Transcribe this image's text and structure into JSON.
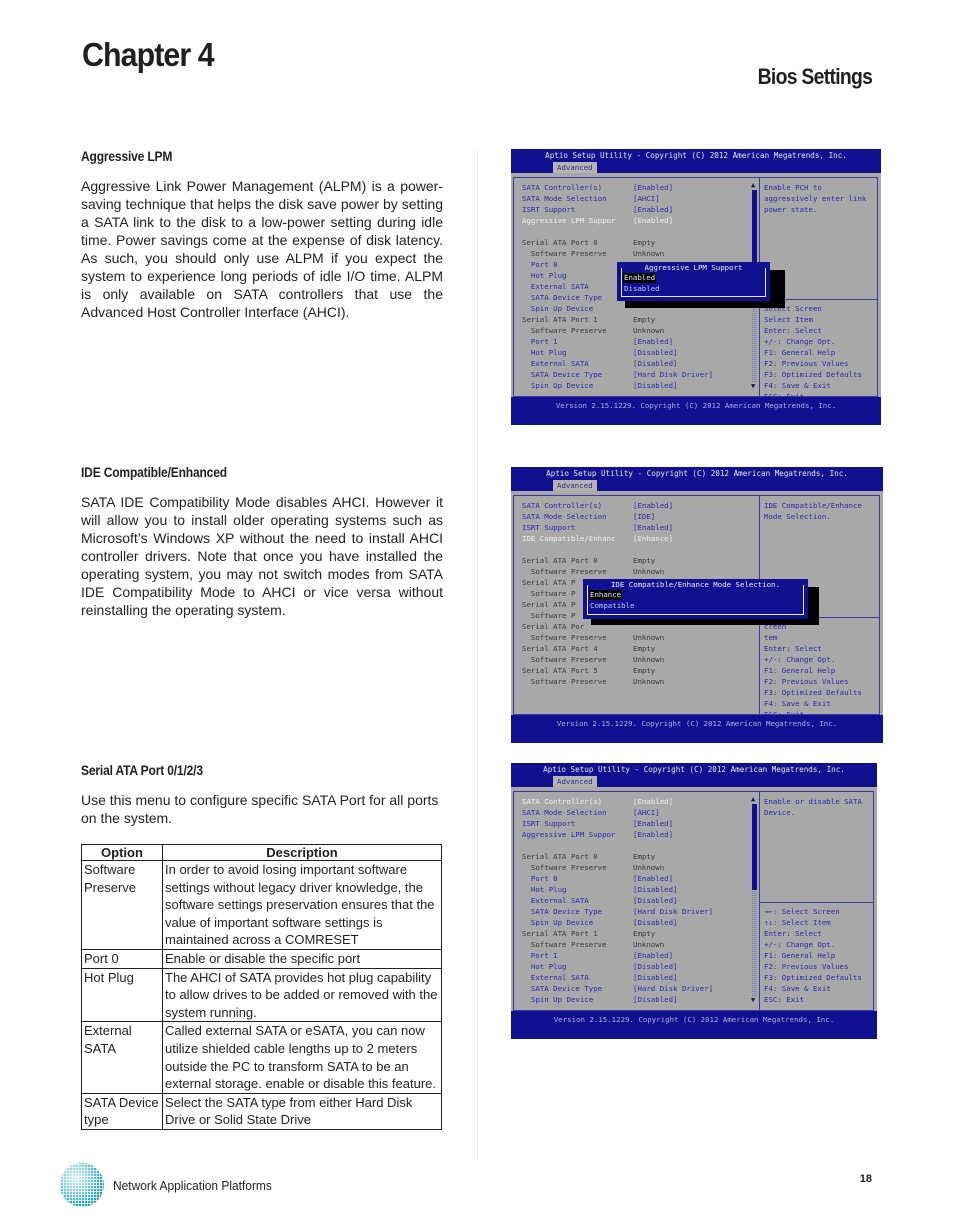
{
  "header": {
    "chapter": "Chapter 4",
    "section": "Bios Settings"
  },
  "sections": [
    {
      "heading": "Aggressive LPM",
      "paragraph": "Aggressive Link Power Management (ALPM) is a power-saving technique that helps the disk save power by setting a SATA link to the disk to a low-power setting during idle time.  Power savings come at the expense of disk latency.  As such, you should only use ALPM if you expect the system to experience long periods of idle I/O time.  ALPM is only available on SATA controllers that use the Advanced Host Controller Interface (AHCI)."
    },
    {
      "heading": "IDE Compatible/Enhanced",
      "paragraph": "SATA IDE Compatibility Mode disables AHCI. However it will allow you to install older operating systems such as Microsoft’s Windows XP without the need to install AHCI controller drivers.  Note that once you have installed the operating system, you may not switch modes from SATA IDE Compatibility Mode to AHCI or vice versa without reinstalling the operating system."
    },
    {
      "heading": "Serial ATA Port 0/1/2/3",
      "paragraph": "Use this menu to configure specific SATA Port for all ports on the system.",
      "table": {
        "headers": [
          "Option",
          "Description"
        ],
        "rows": [
          {
            "option": "Software Preserve",
            "description": "In order to avoid losing important software settings without legacy driver knowledge, the software settings preservation ensures that the value of important software settings is maintained across a COMRESET"
          },
          {
            "option": "Port 0",
            "description": "Enable or disable the specific port"
          },
          {
            "option": "Hot Plug",
            "description": "The AHCI of SATA provides hot plug capability to allow drives to be added or removed with the system running."
          },
          {
            "option": "External SATA",
            "description": "Called external SATA or eSATA, you can now utilize shielded cable lengths up to 2 meters outside the PC to transform SATA to be an external storage. enable or disable this feature."
          },
          {
            "option": "SATA Device type",
            "description": "Select the SATA type from either Hard Disk Drive or Solid State Drive"
          }
        ]
      }
    }
  ],
  "bios_common": {
    "title": "Aptio Setup Utility - Copyright (C) 2012 American Megatrends, Inc.",
    "tab": "Advanced",
    "version": "Version 2.15.1229. Copyright (C) 2012 American Megatrends, Inc."
  },
  "bios1": {
    "rows": [
      {
        "label": "SATA Controller(s)",
        "value": "[Enabled]"
      },
      {
        "label": "SATA Mode Selection",
        "value": "[AHCI]"
      },
      {
        "label": "ISRT Support",
        "value": "[Enabled]"
      },
      {
        "label": "Aggressive LPM Suppor",
        "value": "[Enabled]"
      },
      {
        "label": "",
        "value": ""
      },
      {
        "label": "Serial ATA Port 0",
        "value": "Empty"
      },
      {
        "label": "  Software Preserve",
        "value": "Unknown"
      },
      {
        "label": "  Port 0",
        "value": ""
      },
      {
        "label": "  Hot Plug",
        "value": ""
      },
      {
        "label": "  External SATA",
        "value": ""
      },
      {
        "label": "  SATA Device Type",
        "value": ""
      },
      {
        "label": "  Spin Up Device",
        "value": ""
      },
      {
        "label": "Serial ATA Port 1",
        "value": "Empty"
      },
      {
        "label": "  Software Preserve",
        "value": "Unknown"
      },
      {
        "label": "  Port 1",
        "value": "[Enabled]"
      },
      {
        "label": "  Hot Plug",
        "value": "[Disabled]"
      },
      {
        "label": "  External SATA",
        "value": "[Disabled]"
      },
      {
        "label": "  SATA Device Type",
        "value": "[Hard Disk Driver]"
      },
      {
        "label": "  Spin Up Device",
        "value": "[Disabled]"
      }
    ],
    "help": [
      "Enable PCH to",
      "aggressively enter link",
      "power state."
    ],
    "keys": [
      "Select Screen",
      "Select Item",
      "Enter: Select",
      "+/-: Change Opt.",
      "F1: General Help",
      "F2: Previous Values",
      "F3: Optimized Defaults",
      "F4: Save & Exit",
      "ESC: Exit"
    ],
    "popup": {
      "title": "Aggressive LPM Support",
      "options": [
        "Enabled",
        "Disabled"
      ],
      "selected": "Enabled"
    }
  },
  "bios2": {
    "rows": [
      {
        "label": "SATA Controller(s)",
        "value": "[Enabled]"
      },
      {
        "label": "SATA Mode Selection",
        "value": "[IDE]"
      },
      {
        "label": "ISRT Support",
        "value": "[Enabled]"
      },
      {
        "label": "IDE Compatible/Enhanc",
        "value": "[Enhance]"
      },
      {
        "label": "",
        "value": ""
      },
      {
        "label": "Serial ATA Port 0",
        "value": "Empty"
      },
      {
        "label": "  Software Preserve",
        "value": "Unknown"
      },
      {
        "label": "Serial ATA P",
        "value": ""
      },
      {
        "label": "  Software P",
        "value": ""
      },
      {
        "label": "Serial ATA P",
        "value": ""
      },
      {
        "label": "  Software P",
        "value": ""
      },
      {
        "label": "Serial ATA Por",
        "value": ""
      },
      {
        "label": "  Software Preserve",
        "value": "Unknown"
      },
      {
        "label": "Serial ATA Port 4",
        "value": "Empty"
      },
      {
        "label": "  Software Preserve",
        "value": "Unknown"
      },
      {
        "label": "Serial ATA Port 5",
        "value": "Empty"
      },
      {
        "label": "  Software Preserve",
        "value": "Unknown"
      }
    ],
    "help": [
      "IDE Compatible/Enhance",
      "Mode Selection."
    ],
    "keys": [
      "creen",
      "tem",
      "Enter: Select",
      "+/-: Change Opt.",
      "F1: General Help",
      "F2: Previous Values",
      "F3: Optimized Defaults",
      "F4: Save & Exit",
      "ESC: Exit"
    ],
    "popup": {
      "title": "IDE Compatible/Enhance Mode Selection.",
      "options": [
        "Enhance",
        "Compatible"
      ],
      "selected": "Enhance"
    }
  },
  "bios3": {
    "rows": [
      {
        "label": "SATA Controller(s)",
        "value": "[Enabled]"
      },
      {
        "label": "SATA Mode Selection",
        "value": "[AHCI]"
      },
      {
        "label": "ISRT Support",
        "value": "[Enabled]"
      },
      {
        "label": "Aggressive LPM Suppor",
        "value": "[Enabled]"
      },
      {
        "label": "",
        "value": ""
      },
      {
        "label": "Serial ATA Port 0",
        "value": "Empty"
      },
      {
        "label": "  Software Preserve",
        "value": "Unknown"
      },
      {
        "label": "  Port 0",
        "value": "[Enabled]"
      },
      {
        "label": "  Hot Plug",
        "value": "[Disabled]"
      },
      {
        "label": "  External SATA",
        "value": "[Disabled]"
      },
      {
        "label": "  SATA Device Type",
        "value": "[Hard Disk Driver]"
      },
      {
        "label": "  Spin Up Device",
        "value": "[Disabled]"
      },
      {
        "label": "Serial ATA Port 1",
        "value": "Empty"
      },
      {
        "label": "  Software Preserve",
        "value": "Unknown"
      },
      {
        "label": "  Port 1",
        "value": "[Enabled]"
      },
      {
        "label": "  Hot Plug",
        "value": "[Disabled]"
      },
      {
        "label": "  External SATA",
        "value": "[Disabled]"
      },
      {
        "label": "  SATA Device Type",
        "value": "[Hard Disk Driver]"
      },
      {
        "label": "  Spin Up Device",
        "value": "[Disabled]"
      }
    ],
    "help": [
      "Enable or disable SATA",
      "Device."
    ],
    "keys": [
      "→←: Select Screen",
      "↑↓: Select Item",
      "Enter: Select",
      "+/-: Change Opt.",
      "F1: General Help",
      "F2: Previous Values",
      "F3: Optimized Defaults",
      "F4: Save & Exit",
      "ESC: Exit"
    ]
  },
  "footer": {
    "company_tagline": "Network Application Platforms",
    "page_number": "18",
    "logo_icon": "globe-dots-icon"
  }
}
